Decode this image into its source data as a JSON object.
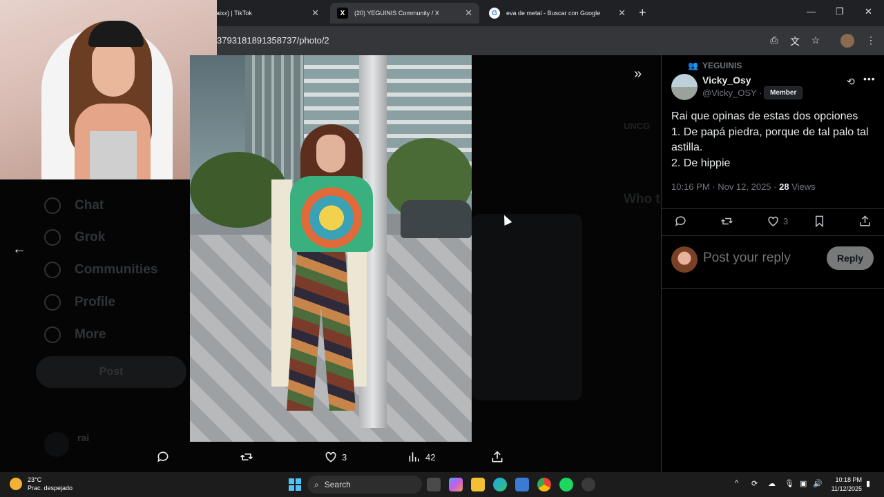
{
  "browser": {
    "tabs": [
      {
        "title": "raixx) | TikTok",
        "active": false
      },
      {
        "title": "(20) YEGUINIS Community / X",
        "active": true
      },
      {
        "title": "eva de metal - Buscar con Google",
        "active": false
      }
    ],
    "url": "3793181891358737/photo/2"
  },
  "x_background": {
    "nav": [
      "Chat",
      "Grok",
      "Communities",
      "Profile",
      "More"
    ],
    "post_label": "Post",
    "profile_name": "rai",
    "side_text_1": "UNCG",
    "side_text_2": "Who t"
  },
  "photo_actions": {
    "likes": "3",
    "views": "42"
  },
  "tweet": {
    "community": "YEGUINIS",
    "user_name": "Vicky_Osy",
    "user_handle": "@Vicky_OSY ·",
    "badge": "Member",
    "lines": [
      "Rai que opinas de estas dos opciones",
      "1. De papá piedra, porque de tal palo tal",
      "astilla.",
      "2. De hippie"
    ],
    "timestamp": "10:16 PM · Nov 12, 2025 ·",
    "views_count": "28",
    "views_label": "Views",
    "likes": "3",
    "reply_placeholder": "Post your reply",
    "reply_button": "Reply"
  },
  "taskbar": {
    "temperature": "23°C",
    "weather": "Prac. despejado",
    "search_label": "Search",
    "time": "10:18 PM",
    "date": "11/12/2025"
  },
  "colors": {
    "x_text": "#e7e9ea",
    "x_muted": "#71767b",
    "border": "#2f3336",
    "chrome_bg": "#202124"
  }
}
